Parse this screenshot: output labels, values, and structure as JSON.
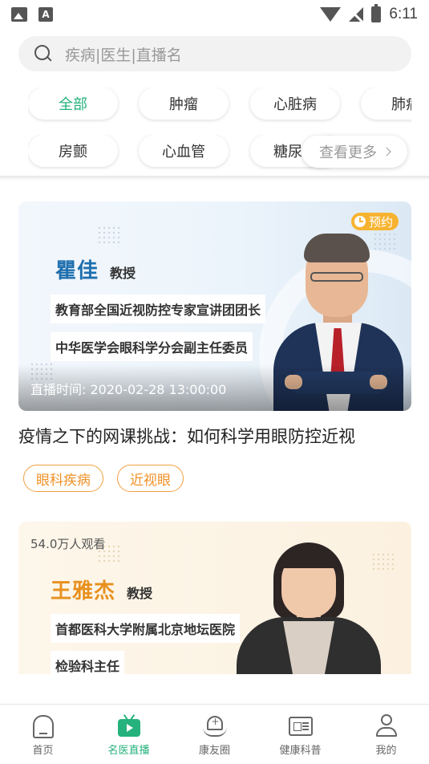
{
  "status_bar": {
    "time": "6:11",
    "notification_letter": "A"
  },
  "search": {
    "placeholder": "疾病|医生|直播名"
  },
  "categories": {
    "row1": [
      "全部",
      "肿瘤",
      "心脏病",
      "肺病"
    ],
    "row2": [
      "房颤",
      "心血管",
      "糖尿病"
    ],
    "active": "全部",
    "more_label": "查看更多"
  },
  "cards": [
    {
      "doctor_name": "瞿佳",
      "doctor_title": "教授",
      "affiliations": [
        "教育部全国近视防控专家宣讲团团长",
        "中华医学会眼科学分会副主任委员"
      ],
      "badge": "预约",
      "live_time": "直播时间: 2020-02-28 13:00:00",
      "title": "疫情之下的网课挑战：如何科学用眼防控近视",
      "tags": [
        "眼科疾病",
        "近视眼"
      ],
      "name_color": "#1f6fae"
    },
    {
      "viewers": "54.0万人观看",
      "doctor_name": "王雅杰",
      "doctor_title": "教授",
      "affiliations": [
        "首都医科大学附属北京地坛医院",
        "检验科主任"
      ],
      "name_color": "#e8901e"
    }
  ],
  "bottom_nav": [
    {
      "label": "首页",
      "icon": "home-icon"
    },
    {
      "label": "名医直播",
      "icon": "tv-play-icon",
      "active": true
    },
    {
      "label": "康友圈",
      "icon": "heart-hands-icon"
    },
    {
      "label": "健康科普",
      "icon": "news-card-icon"
    },
    {
      "label": "我的",
      "icon": "user-icon"
    }
  ],
  "colors": {
    "accent": "#26b27c",
    "tag_orange": "#f0922a",
    "badge": "#f7b330"
  }
}
